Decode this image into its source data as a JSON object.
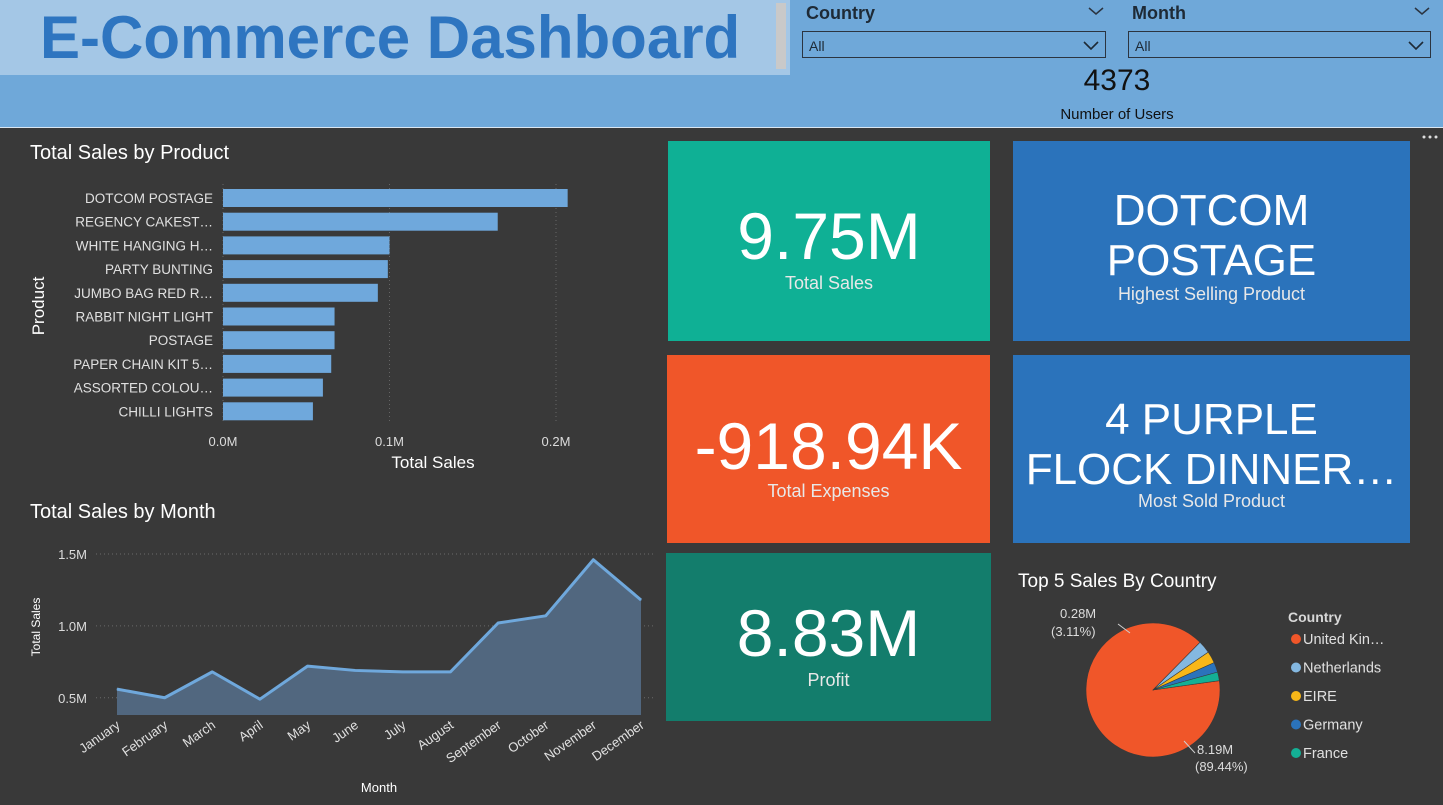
{
  "header": {
    "title": "E-Commerce Dashboard",
    "slicers": [
      {
        "label": "Country",
        "value": "All"
      },
      {
        "label": "Month",
        "value": "All"
      }
    ],
    "users": {
      "value": "4373",
      "label": "Number of Users"
    }
  },
  "cards": {
    "total_sales": {
      "value": "9.75M",
      "label": "Total Sales",
      "color": "#0fb095"
    },
    "total_expenses": {
      "value": "-918.94K",
      "label": "Total Expenses",
      "color": "#f05629"
    },
    "profit": {
      "value": "8.83M",
      "label": "Profit",
      "color": "#137d6c"
    },
    "highest_selling": {
      "line1": "DOTCOM",
      "line2": "POSTAGE",
      "label": "Highest Selling Product",
      "color": "#2b73bb"
    },
    "most_sold": {
      "line1": "4 PURPLE",
      "line2": "FLOCK DINNER…",
      "label": "Most Sold Product",
      "color": "#2b73bb"
    }
  },
  "chart_data": [
    {
      "type": "bar",
      "orientation": "horizontal",
      "title": "Total Sales by Product",
      "xlabel": "Total Sales",
      "ylabel": "Product",
      "categories": [
        "DOTCOM POSTAGE",
        "REGENCY CAKEST…",
        "WHITE HANGING H…",
        "PARTY BUNTING",
        "JUMBO BAG RED R…",
        "RABBIT NIGHT LIGHT",
        "POSTAGE",
        "PAPER CHAIN KIT 5…",
        "ASSORTED COLOU…",
        "CHILLI LIGHTS"
      ],
      "values": [
        0.207,
        0.165,
        0.1,
        0.099,
        0.093,
        0.067,
        0.067,
        0.065,
        0.06,
        0.054
      ],
      "xticks": [
        "0.0M",
        "0.1M",
        "0.2M"
      ],
      "xlim": [
        0,
        0.25
      ],
      "grid": true,
      "color": "#6fa8dc"
    },
    {
      "type": "area",
      "title": "Total Sales by Month",
      "xlabel": "Month",
      "ylabel": "Total Sales",
      "categories": [
        "January",
        "February",
        "March",
        "April",
        "May",
        "June",
        "July",
        "August",
        "September",
        "October",
        "November",
        "December"
      ],
      "values": [
        0.56,
        0.5,
        0.68,
        0.49,
        0.72,
        0.69,
        0.68,
        0.68,
        1.02,
        1.07,
        1.46,
        1.18
      ],
      "yticks": [
        "0.5M",
        "1.0M",
        "1.5M"
      ],
      "yticks_values": [
        0.5,
        1.0,
        1.5
      ],
      "ylim": [
        0.38,
        1.5
      ],
      "grid": true,
      "color": "#6fa8dc"
    },
    {
      "type": "pie",
      "title": "Top 5 Sales By Country",
      "legend_title": "Country",
      "legend_position": "right",
      "slices": [
        {
          "name": "United Kin…",
          "value": 8.19,
          "percent": 89.44,
          "color": "#f05629",
          "label_value": "8.19M",
          "label_pct": "(89.44%)"
        },
        {
          "name": "Netherlands",
          "value": 0.28,
          "percent": 3.11,
          "color": "#84b8e1",
          "label_value": "0.28M",
          "label_pct": "(3.11%)"
        },
        {
          "name": "EIRE",
          "value": 0.26,
          "percent": 2.9,
          "color": "#f7b718",
          "label_value": "",
          "label_pct": ""
        },
        {
          "name": "Germany",
          "value": 0.22,
          "percent": 2.5,
          "color": "#2b73bb",
          "label_value": "",
          "label_pct": ""
        },
        {
          "name": "France",
          "value": 0.19,
          "percent": 2.05,
          "color": "#14b095",
          "label_value": "",
          "label_pct": ""
        }
      ]
    }
  ]
}
